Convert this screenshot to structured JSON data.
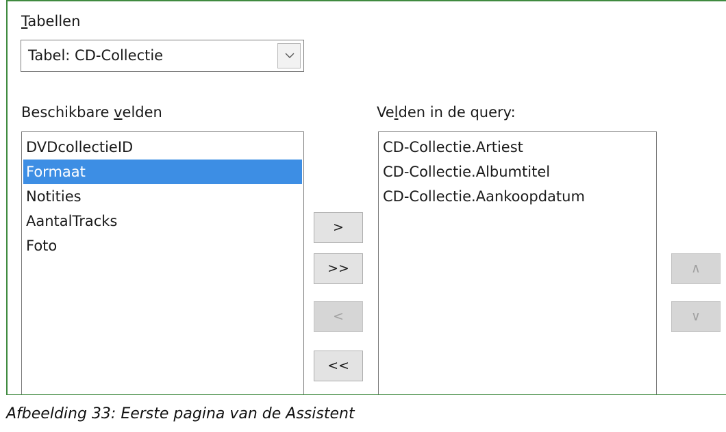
{
  "tables": {
    "label_prefix": "",
    "label_underline": "T",
    "label_rest": "abellen",
    "selected": "Tabel: CD-Collectie",
    "dropdown_icon": "chevron-down-icon"
  },
  "available": {
    "label_pre": "Beschikbare ",
    "label_underline": "v",
    "label_post": "elden",
    "items": [
      "DVDcollectieID",
      "Formaat",
      "Notities",
      "AantalTracks",
      "Foto"
    ],
    "selected_index": 1
  },
  "query": {
    "label_pre": "Ve",
    "label_underline": "l",
    "label_post": "den in de query:",
    "items": [
      "CD-Collectie.Artiest",
      "CD-Collectie.Albumtitel",
      "CD-Collectie.Aankoopdatum"
    ]
  },
  "transfer_buttons": {
    "add": ">",
    "add_all": ">>",
    "remove": "<",
    "remove_all": "<<"
  },
  "order_buttons": {
    "up": "∧",
    "down": "∨"
  },
  "caption": "Afbeelding 33: Eerste pagina van de Assistent",
  "colors": {
    "selection": "#3d8ee4",
    "frame_border": "#3f8a3f"
  }
}
